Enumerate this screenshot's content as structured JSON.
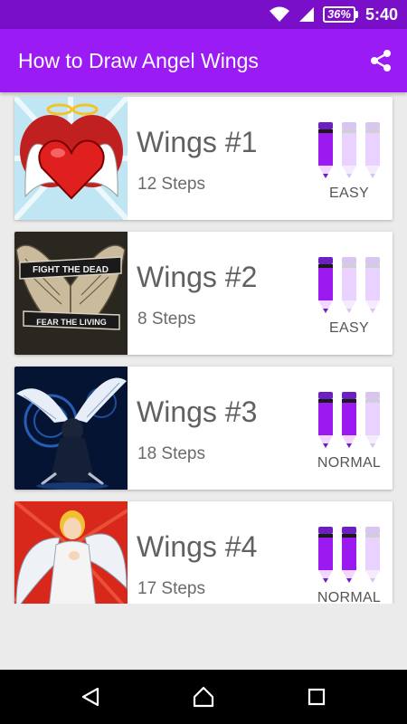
{
  "status_bar": {
    "battery": "36%",
    "time": "5:40"
  },
  "app_bar": {
    "title": "How to Draw Angel Wings",
    "share_icon": "share-icon"
  },
  "colors": {
    "status": "#7a0fc9",
    "app_bar": "#9b1bf5",
    "pencil_on": "#9a1af0",
    "pencil_off": "#e9d2ff"
  },
  "tutorials": [
    {
      "title": "Wings #1",
      "steps": "12 Steps",
      "difficulty": "EASY",
      "level": 1,
      "max_level": 3
    },
    {
      "title": "Wings #2",
      "steps": "8 Steps",
      "difficulty": "EASY",
      "level": 1,
      "max_level": 3
    },
    {
      "title": "Wings #3",
      "steps": "18 Steps",
      "difficulty": "NORMAL",
      "level": 2,
      "max_level": 3
    },
    {
      "title": "Wings #4",
      "steps": "17 Steps",
      "difficulty": "NORMAL",
      "level": 2,
      "max_level": 3
    }
  ],
  "thumbnail_text": {
    "banner_top": "FIGHT THE DEAD",
    "banner_bottom": "FEAR THE LIVING"
  },
  "nav": {
    "back_icon": "back-icon",
    "home_icon": "home-icon",
    "recents_icon": "recents-icon"
  }
}
